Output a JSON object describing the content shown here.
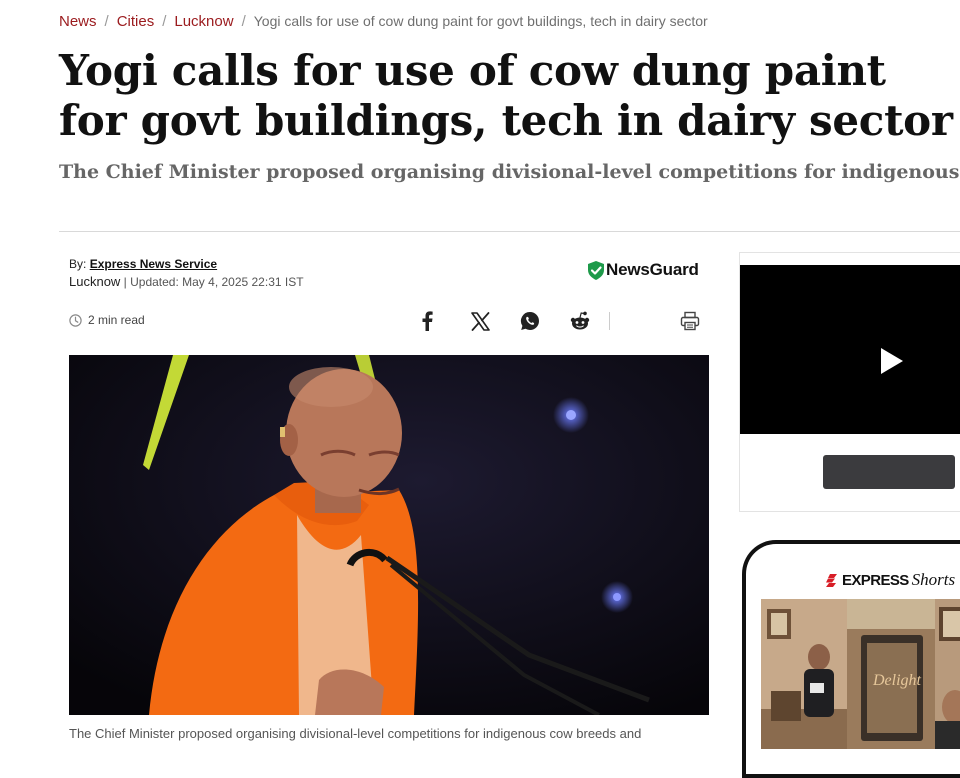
{
  "breadcrumb": {
    "items": [
      "News",
      "Cities",
      "Lucknow"
    ],
    "separator": "/",
    "current": "Yogi calls for use of cow dung paint for govt buildings, tech in dairy sector"
  },
  "article": {
    "headline": "Yogi calls for use of cow dung paint for govt buildings, tech in dairy sector",
    "standfirst": "The Chief Minister proposed organising divisional-level competitions for indigenous cow breeds and recognising exemplary ‘Gau Ashray Sthals’.",
    "byline_label": "By:",
    "author": "Express News Service",
    "location": "Lucknow",
    "updated": " | Updated: May 4, 2025 22:31 IST",
    "read_time": "2 min read",
    "caption": "The Chief Minister proposed organising divisional-level competitions for indigenous cow breeds and"
  },
  "newsguard": {
    "label": "NewsGuard",
    "color": "#1e9a4a"
  },
  "share": {
    "icons": [
      "facebook-icon",
      "x-icon",
      "whatsapp-icon",
      "reddit-icon",
      "print-icon"
    ]
  },
  "video_widget": {
    "icon": "play-icon"
  },
  "shorts": {
    "brand": "EXPRESS",
    "brand_suffix": "Shorts",
    "accent": "#d81e27",
    "thumb_text": "Delight"
  },
  "colors": {
    "link_red": "#9b1b1e",
    "headline": "#111111",
    "subhead": "#666666"
  }
}
